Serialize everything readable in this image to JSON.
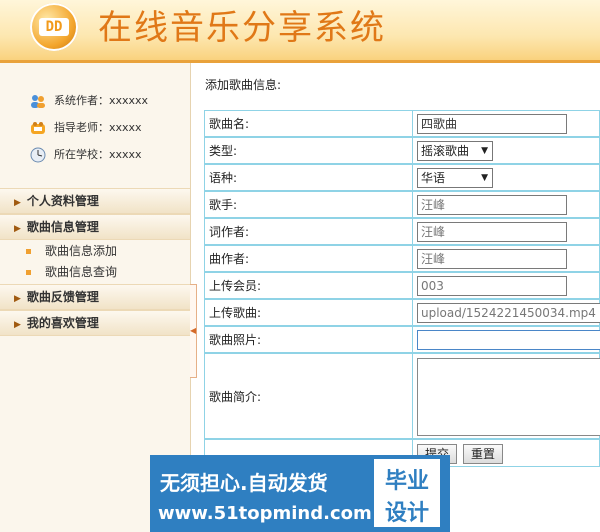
{
  "header": {
    "logo_text": "DD",
    "title": "在线音乐分享系统"
  },
  "sidebar": {
    "info": [
      {
        "icon": "users-icon",
        "text": "系统作者：xxxxxx"
      },
      {
        "icon": "teacher-icon",
        "text": "指导老师：xxxxx"
      },
      {
        "icon": "school-icon",
        "text": "所在学校：xxxxx"
      }
    ],
    "menus": [
      {
        "label": "个人资料管理"
      },
      {
        "label": "歌曲信息管理",
        "items": [
          "歌曲信息添加",
          "歌曲信息查询"
        ]
      },
      {
        "label": "歌曲反馈管理"
      },
      {
        "label": "我的喜欢管理"
      }
    ]
  },
  "form": {
    "heading": "添加歌曲信息:",
    "fields": {
      "name": {
        "label": "歌曲名:",
        "value": "四歌曲"
      },
      "type": {
        "label": "类型:",
        "value": "摇滚歌曲"
      },
      "lang": {
        "label": "语种:",
        "value": "华语"
      },
      "singer": {
        "label": "歌手:",
        "value": "汪峰"
      },
      "lyricist": {
        "label": "词作者:",
        "value": "汪峰"
      },
      "composer": {
        "label": "曲作者:",
        "value": "汪峰"
      },
      "uploader": {
        "label": "上传会员:",
        "value": "003"
      },
      "file": {
        "label": "上传歌曲:",
        "value": "upload/1524221450034.mp4"
      },
      "photo": {
        "label": "歌曲照片:",
        "value": ""
      },
      "intro": {
        "label": "歌曲简介:",
        "value": ""
      }
    },
    "buttons": {
      "submit": "提交",
      "reset": "重置"
    }
  },
  "banner": {
    "line1": "无须担心.自动发货",
    "line2": "www.51topmind.com",
    "box1": "毕业",
    "box2": "设计"
  },
  "colors": {
    "accent": "#e07817",
    "border": "#8fd3e6",
    "banner": "#2f7fc1"
  }
}
